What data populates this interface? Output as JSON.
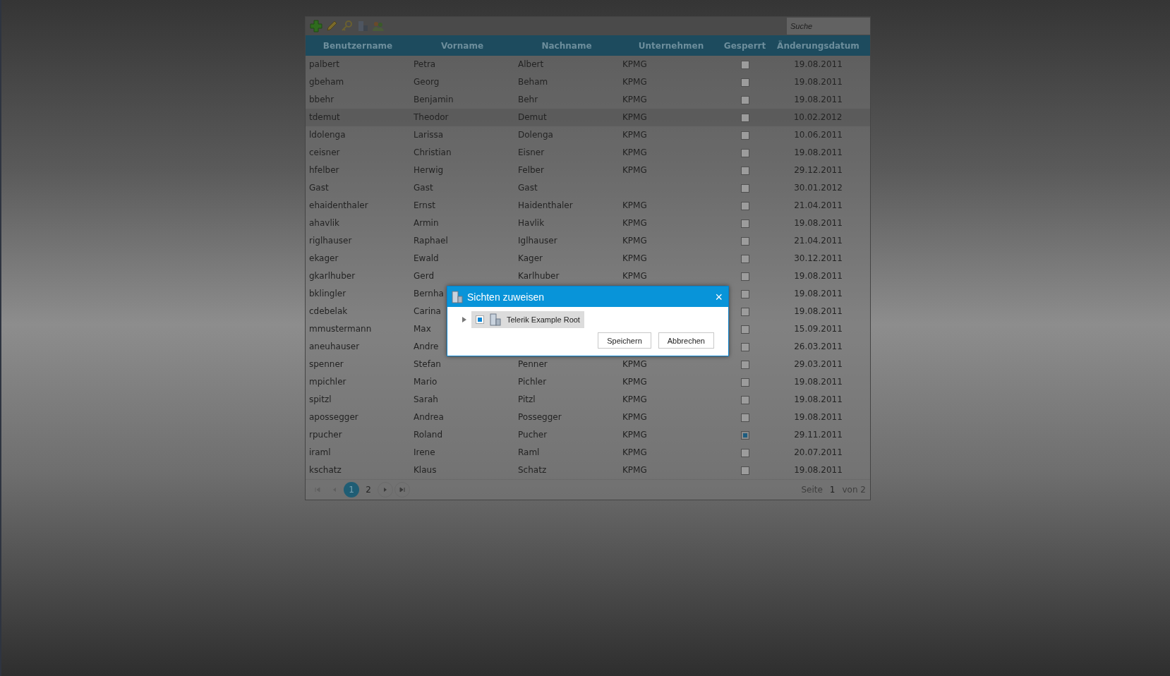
{
  "toolbar": {
    "search": {
      "placeholder": "Suche"
    }
  },
  "table": {
    "columns": [
      "Benutzername",
      "Vorname",
      "Nachname",
      "Unternehmen",
      "Gesperrt",
      "Änderungsdatum"
    ],
    "rows": [
      {
        "user": "palbert",
        "first": "Petra",
        "last": "Albert",
        "company": "KPMG",
        "locked": false,
        "date": "19.08.2011",
        "selected": false
      },
      {
        "user": "gbeham",
        "first": "Georg",
        "last": "Beham",
        "company": "KPMG",
        "locked": false,
        "date": "19.08.2011",
        "selected": false
      },
      {
        "user": "bbehr",
        "first": "Benjamin",
        "last": "Behr",
        "company": "KPMG",
        "locked": false,
        "date": "19.08.2011",
        "selected": false
      },
      {
        "user": "tdemut",
        "first": "Theodor",
        "last": "Demut",
        "company": "KPMG",
        "locked": false,
        "date": "10.02.2012",
        "selected": true
      },
      {
        "user": "ldolenga",
        "first": "Larissa",
        "last": "Dolenga",
        "company": "KPMG",
        "locked": false,
        "date": "10.06.2011",
        "selected": false
      },
      {
        "user": "ceisner",
        "first": "Christian",
        "last": "Eisner",
        "company": "KPMG",
        "locked": false,
        "date": "19.08.2011",
        "selected": false
      },
      {
        "user": "hfelber",
        "first": "Herwig",
        "last": "Felber",
        "company": "KPMG",
        "locked": false,
        "date": "29.12.2011",
        "selected": false
      },
      {
        "user": "Gast",
        "first": "Gast",
        "last": "Gast",
        "locked": false,
        "date": "30.01.2012",
        "selected": false
      },
      {
        "user": "ehaidenthaler",
        "first": "Ernst",
        "last": "Haidenthaler",
        "company": "KPMG",
        "locked": false,
        "date": "21.04.2011",
        "selected": false
      },
      {
        "user": "ahavlik",
        "first": "Armin",
        "last": "Havlik",
        "company": "KPMG",
        "locked": false,
        "date": "19.08.2011",
        "selected": false
      },
      {
        "user": "riglhauser",
        "first": "Raphael",
        "last": "Iglhauser",
        "company": "KPMG",
        "locked": false,
        "date": "21.04.2011",
        "selected": false
      },
      {
        "user": "ekager",
        "first": "Ewald",
        "last": "Kager",
        "company": "KPMG",
        "locked": false,
        "date": "30.12.2011",
        "selected": false
      },
      {
        "user": "gkarlhuber",
        "first": "Gerd",
        "last": "Karlhuber",
        "company": "KPMG",
        "locked": false,
        "date": "19.08.2011",
        "selected": false
      },
      {
        "user": "bklingler",
        "first": "Bernha",
        "locked": false,
        "date": "19.08.2011",
        "selected": false
      },
      {
        "user": "cdebelak",
        "first": "Carina",
        "locked": false,
        "date": "19.08.2011",
        "selected": false
      },
      {
        "user": "mmustermann",
        "first": "Max",
        "locked": false,
        "date": "15.09.2011",
        "selected": false
      },
      {
        "user": "aneuhauser",
        "first": "Andre",
        "locked": false,
        "date": "26.03.2011",
        "selected": false
      },
      {
        "user": "spenner",
        "first": "Stefan",
        "last": "Penner",
        "company": "KPMG",
        "locked": false,
        "date": "29.03.2011",
        "selected": false
      },
      {
        "user": "mpichler",
        "first": "Mario",
        "last": "Pichler",
        "company": "KPMG",
        "locked": false,
        "date": "19.08.2011",
        "selected": false
      },
      {
        "user": "spitzl",
        "first": "Sarah",
        "last": "Pitzl",
        "company": "KPMG",
        "locked": false,
        "date": "19.08.2011",
        "selected": false
      },
      {
        "user": "apossegger",
        "first": "Andrea",
        "last": "Possegger",
        "company": "KPMG",
        "locked": false,
        "date": "19.08.2011",
        "selected": false
      },
      {
        "user": "rpucher",
        "first": "Roland",
        "last": "Pucher",
        "company": "KPMG",
        "locked": true,
        "date": "29.11.2011",
        "selected": false
      },
      {
        "user": "iraml",
        "first": "Irene",
        "last": "Raml",
        "company": "KPMG",
        "locked": false,
        "date": "20.07.2011",
        "selected": false
      },
      {
        "user": "kschatz",
        "first": "Klaus",
        "last": "Schatz",
        "company": "KPMG",
        "locked": false,
        "date": "19.08.2011",
        "selected": false
      }
    ]
  },
  "pager": {
    "pages": [
      {
        "label": "1",
        "selected": true
      },
      {
        "label": "2",
        "selected": false
      }
    ],
    "page_label": "Seite",
    "current": "1",
    "of_label": "von 2"
  },
  "dialog": {
    "title": "Sichten zuweisen",
    "close": "×",
    "tree": [
      {
        "label": "Telerik Example Root",
        "expanded": false,
        "checked": true
      }
    ],
    "buttons": [
      "Speichern",
      "Abbrechen"
    ]
  }
}
